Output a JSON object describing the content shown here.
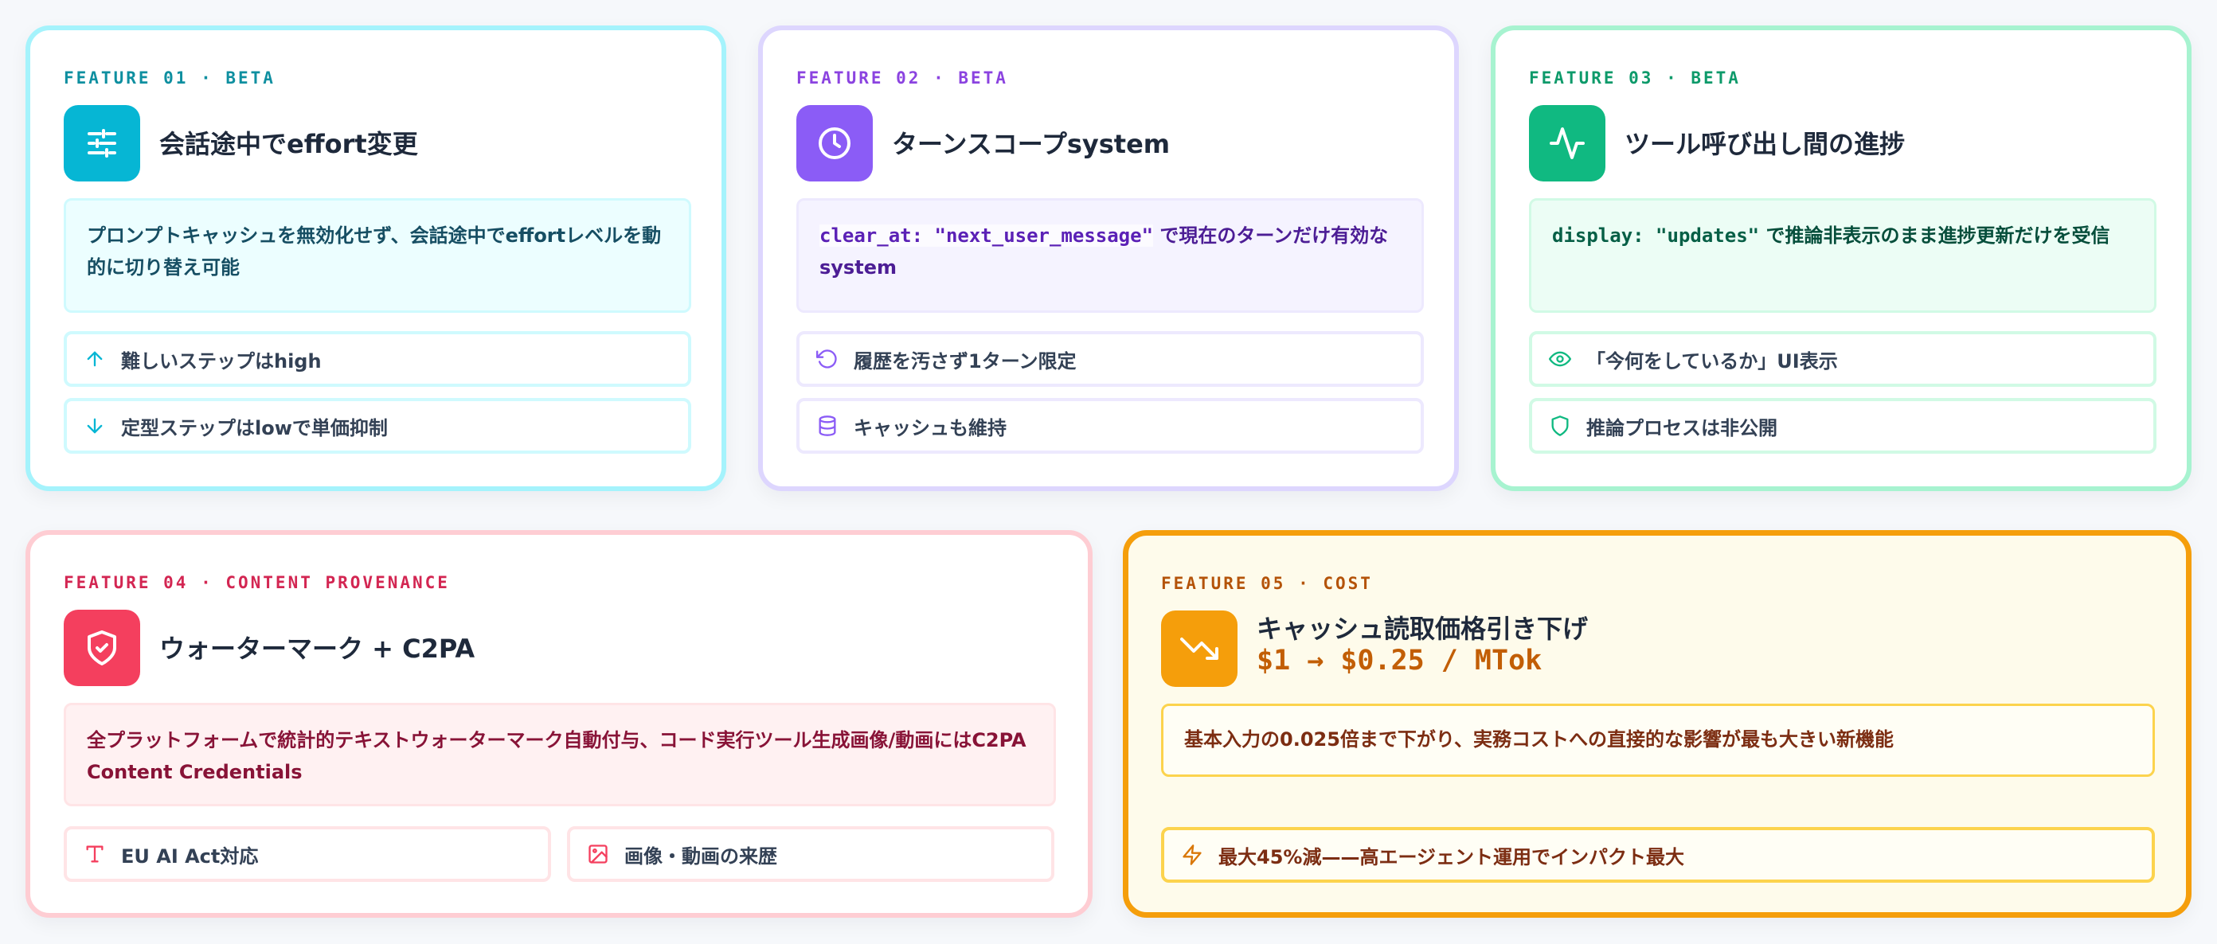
{
  "features": [
    {
      "eyebrow": "FEATURE 01 · BETA",
      "icon": "sliders-icon",
      "title": "会話途中でeffort変更",
      "desc": "プロンプトキャッシュを無効化せず、会話途中でeffortレベルを動的に切り替え可能",
      "pills": [
        {
          "icon": "arrow-up-icon",
          "label": "難しいステップはhigh"
        },
        {
          "icon": "arrow-down-icon",
          "label": "定型ステップはlowで単価抑制"
        }
      ]
    },
    {
      "eyebrow": "FEATURE 02 · BETA",
      "icon": "clock-icon",
      "title": "ターンスコープsystem",
      "desc_code": "clear_at: \"next_user_message\"",
      "desc_text": " で現在のターンだけ有効なsystem",
      "pills": [
        {
          "icon": "rotate-ccw-icon",
          "label": "履歴を汚さず1ターン限定"
        },
        {
          "icon": "database-icon",
          "label": "キャッシュも維持"
        }
      ]
    },
    {
      "eyebrow": "FEATURE 03 · BETA",
      "icon": "activity-icon",
      "title": "ツール呼び出し間の進捗",
      "desc_code": "display: \"updates\"",
      "desc_text": " で推論非表示のまま進捗更新だけを受信",
      "pills": [
        {
          "icon": "eye-icon",
          "label": "「今何をしているか」UI表示"
        },
        {
          "icon": "shield-icon",
          "label": "推論プロセスは非公開"
        }
      ]
    },
    {
      "eyebrow": "FEATURE 04 · CONTENT PROVENANCE",
      "icon": "shield-check-icon",
      "title": "ウォーターマーク + C2PA",
      "desc": "全プラットフォームで統計的テキストウォーターマーク自動付与、コード実行ツール生成画像/動画にはC2PA Content Credentials",
      "pills": [
        {
          "icon": "type-icon",
          "label": "EU AI Act対応"
        },
        {
          "icon": "image-icon",
          "label": "画像・動画の来歴"
        }
      ]
    },
    {
      "eyebrow": "FEATURE 05 · COST",
      "icon": "trending-down-icon",
      "title": "キャッシュ読取価格引き下げ",
      "price": "$1 → $0.25 / MTok",
      "desc": "基本入力の0.025倍まで下がり、実務コストへの直接的な影響が最も大きい新機能",
      "pills": [
        {
          "icon": "zap-icon",
          "label": "最大45%減——高エージェント運用でインパクト最大"
        }
      ]
    }
  ],
  "colors": {
    "cyan": "#06b6d4",
    "violet": "#8b5cf6",
    "emerald": "#10b981",
    "rose": "#f43f5e",
    "amber": "#f59e0b"
  }
}
